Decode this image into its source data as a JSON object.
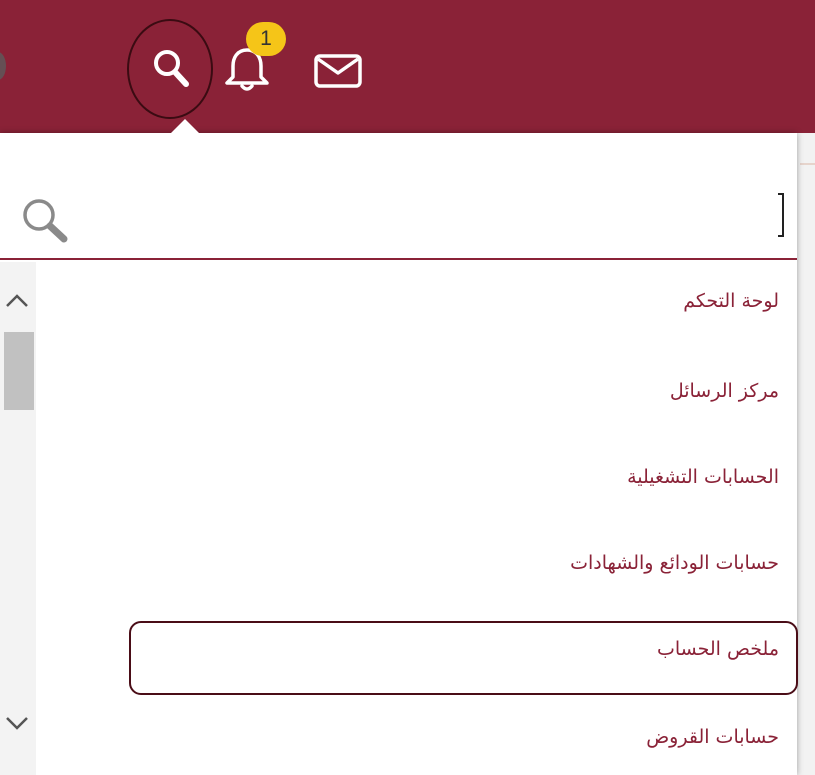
{
  "header": {
    "notification_count": "1",
    "colors": {
      "bar": "#8a2237",
      "badge": "#f5c518"
    },
    "icons": {
      "search": "search-icon",
      "bell": "bell-icon",
      "mail": "mail-icon"
    }
  },
  "search": {
    "value": "",
    "placeholder": "",
    "icon": "search-icon"
  },
  "scrollbar": {
    "up_icon": "chevron-up-icon",
    "down_icon": "chevron-down-icon"
  },
  "menu": {
    "items": [
      {
        "label": "لوحة التحكم"
      },
      {
        "label": "مركز الرسائل"
      },
      {
        "label": "الحسابات التشغيلية"
      },
      {
        "label": "حسابات الودائع والشهادات"
      },
      {
        "label": "ملخص الحساب"
      },
      {
        "label": "حسابات القروض"
      }
    ],
    "highlighted_index": 4,
    "text_color": "#8a2237"
  }
}
